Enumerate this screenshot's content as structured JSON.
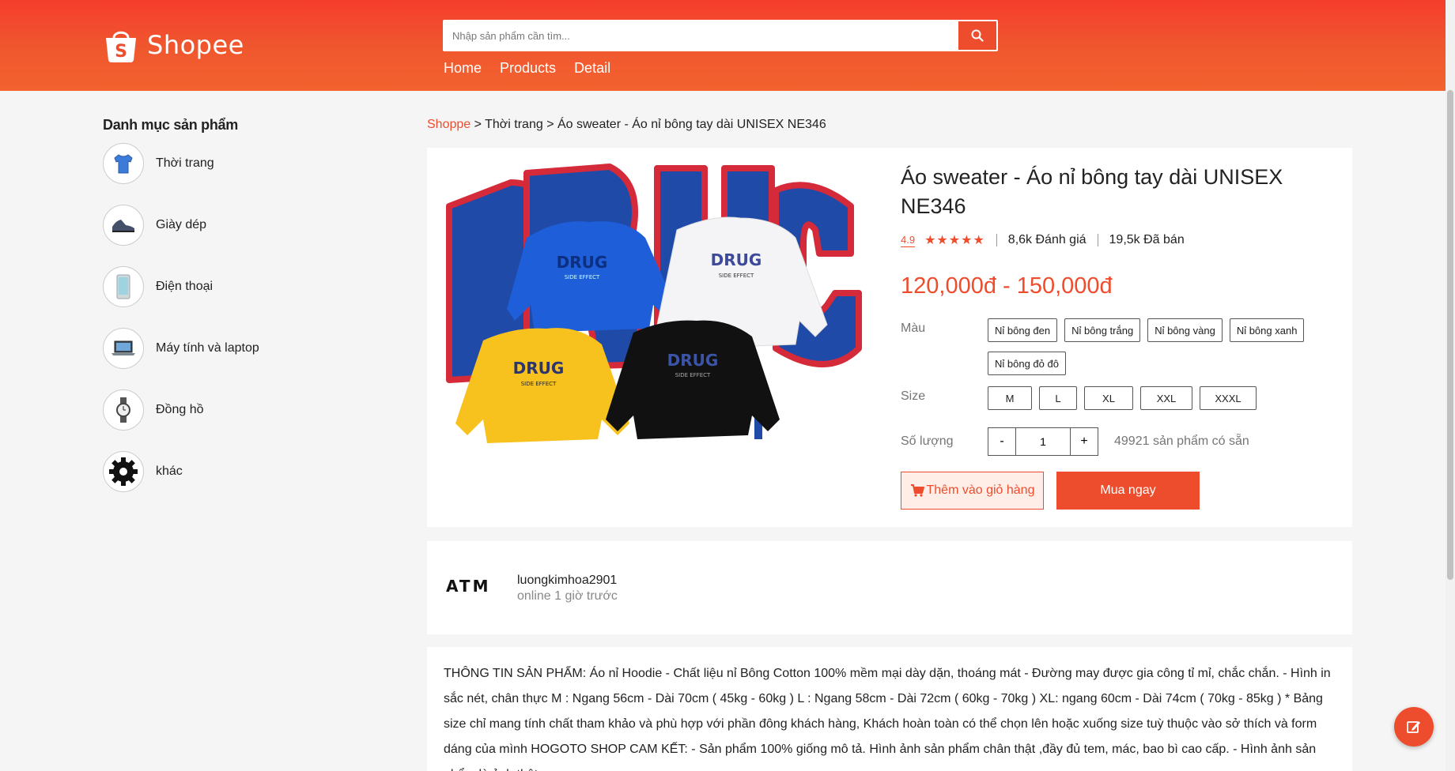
{
  "header": {
    "brand": "Shopee",
    "search_placeholder": "Nhập sản phẩm cần tìm...",
    "nav": [
      "Home",
      "Products",
      "Detail"
    ]
  },
  "sidebar": {
    "title": "Danh mục sản phẩm",
    "items": [
      {
        "label": "Thời trang",
        "icon": "shirt-icon"
      },
      {
        "label": "Giày dép",
        "icon": "shoe-icon"
      },
      {
        "label": "Điện thoại",
        "icon": "phone-icon"
      },
      {
        "label": "Máy tính và laptop",
        "icon": "laptop-icon"
      },
      {
        "label": "Đồng hồ",
        "icon": "watch-icon"
      },
      {
        "label": "khác",
        "icon": "gear-icon"
      }
    ]
  },
  "breadcrumb": {
    "home": "Shoppe",
    "rest": " > Thời trang > Áo sweater - Áo nỉ bông tay dài UNISEX NE346"
  },
  "product": {
    "title": "Áo sweater - Áo nỉ bông tay dài UNISEX NE346",
    "rating": "4.9",
    "stars": "★★★★★",
    "reviews": "8,6k Đánh giá",
    "sold": "19,5k Đã bán",
    "price": "120,000đ - 150,000đ",
    "color_label": "Màu",
    "colors": [
      "Nỉ bông đen",
      "Nỉ bông trắng",
      "Nỉ bông vàng",
      "Nỉ bông xanh",
      "Nỉ bông đỏ đô"
    ],
    "size_label": "Size",
    "sizes": [
      "M",
      "L",
      "XL",
      "XXL",
      "XXXL"
    ],
    "qty_label": "Số lượng",
    "qty_minus": "-",
    "qty_plus": "+",
    "qty_value": "1",
    "stock": "49921 sản phẩm có sẵn",
    "add_to_cart": "Thêm vào giỏ hàng",
    "buy_now": "Mua ngay",
    "image_text": "DRUG",
    "image_subtext": "SIDE EFFECT"
  },
  "shop": {
    "logo_text": "ATM",
    "name": "luongkimhoa2901",
    "online": "online 1 giờ trước"
  },
  "description": "THÔNG TIN SẢN PHẨM: Áo nỉ Hoodie - Chất liệu nỉ Bông Cotton 100% mềm mại dày dặn, thoáng mát - Đường may được gia công tỉ mỉ, chắc chắn. - Hình in sắc nét, chân thực M : Ngang 56cm - Dài 70cm ( 45kg - 60kg ) L : Ngang 58cm - Dài 72cm ( 60kg - 70kg ) XL: ngang 60cm - Dài 74cm ( 70kg - 85kg ) * Bảng size chỉ mang tính chất tham khảo và phù hợp với phần đông khách hàng, Khách hoàn toàn có thể chọn lên hoặc xuống size tuỳ thuộc vào sở thích và form dáng của mình HOGOTO SHOP CAM KẾT: - Sản phẩm 100% giống mô tả. Hình ảnh sản phẩm chân thật ,đầy đủ tem, mác, bao bì cao cấp. - Hình ảnh sản phẩm là ảnh thật",
  "colors": {
    "brand": "#ee4d2d",
    "header_top": "#f53d2d",
    "header_bottom": "#f3622f"
  }
}
